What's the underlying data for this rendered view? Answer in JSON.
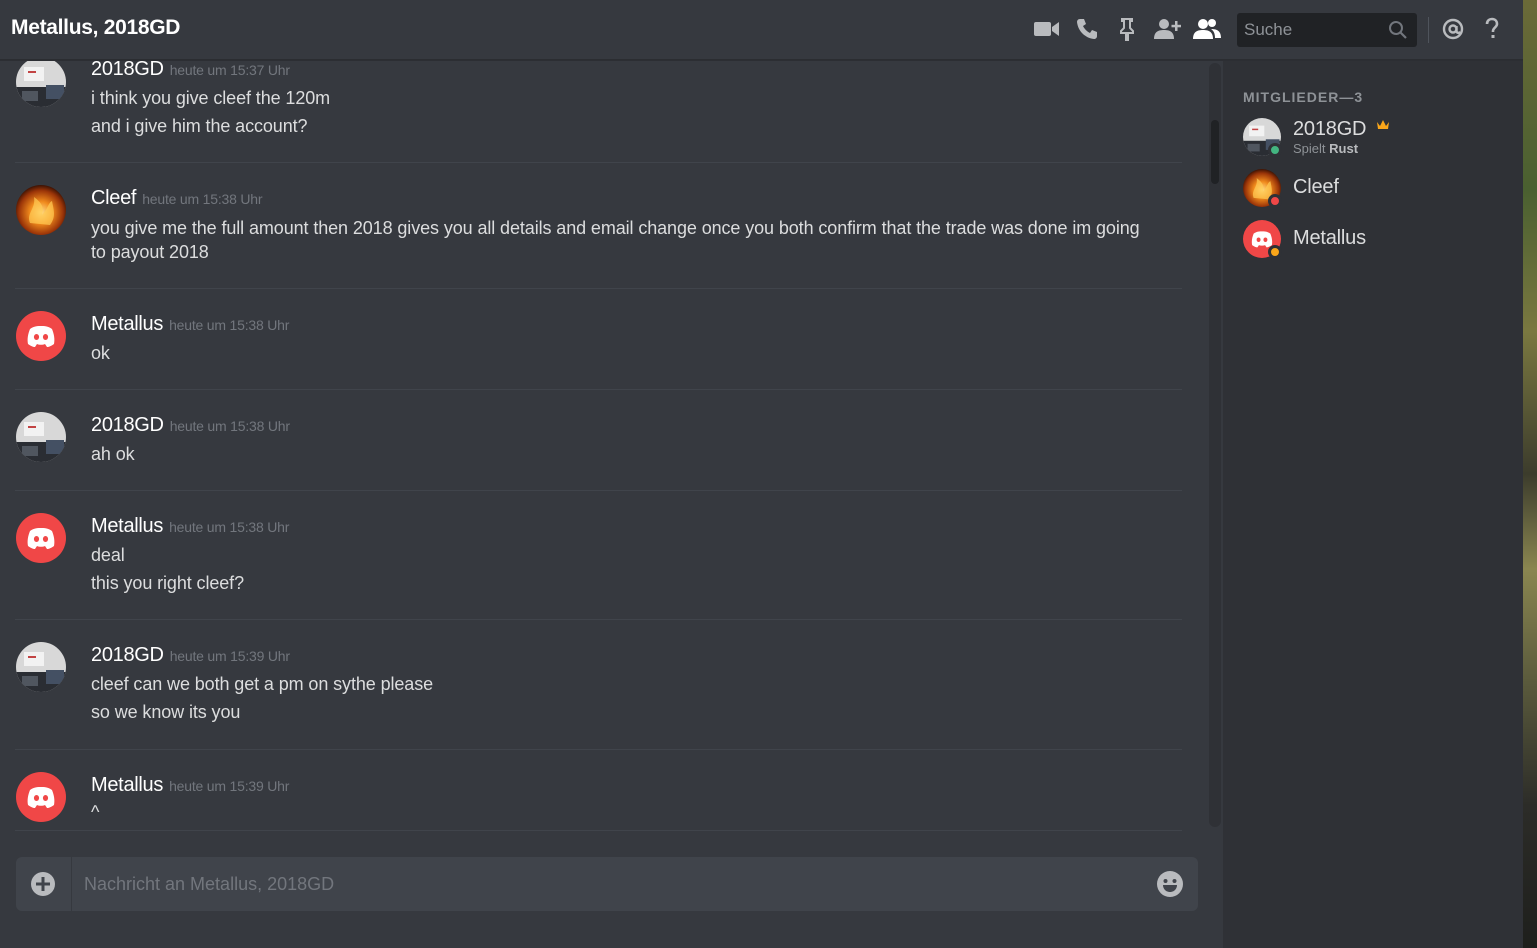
{
  "header": {
    "title": "Metallus, 2018GD",
    "search_placeholder": "Suche"
  },
  "messages": [
    {
      "author": "2018GD",
      "timestamp": "heute um 15:37 Uhr",
      "avatar": "screenshot-avatar",
      "lines": [
        "i think you give cleef the 120m",
        "and i give him the account?"
      ]
    },
    {
      "author": "Cleef",
      "timestamp": "heute um 15:38 Uhr",
      "avatar": "fire-avatar",
      "lines": [
        "you give me the full amount  then 2018 gives you all details and email change once you both confirm that the trade was done im going",
        "to payout 2018"
      ]
    },
    {
      "author": "Metallus",
      "timestamp": "heute um 15:38 Uhr",
      "avatar": "discord-default-avatar",
      "lines": [
        "ok"
      ]
    },
    {
      "author": "2018GD",
      "timestamp": "heute um 15:38 Uhr",
      "avatar": "screenshot-avatar",
      "lines": [
        "ah ok"
      ]
    },
    {
      "author": "Metallus",
      "timestamp": "heute um 15:38 Uhr",
      "avatar": "discord-default-avatar",
      "lines": [
        "deal",
        "this you right cleef?"
      ]
    },
    {
      "author": "2018GD",
      "timestamp": "heute um 15:39 Uhr",
      "avatar": "screenshot-avatar",
      "lines": [
        "cleef can we both  get a pm on sythe please",
        "so we know its you"
      ]
    },
    {
      "author": "Metallus",
      "timestamp": "heute um 15:39 Uhr",
      "avatar": "discord-default-avatar",
      "lines": [
        "^"
      ]
    }
  ],
  "composer": {
    "placeholder": "Nachricht an Metallus, 2018GD"
  },
  "members": {
    "header": "MITGLIEDER—3",
    "list": [
      {
        "name": "2018GD",
        "status": "online",
        "status_color": "#43b581",
        "owner": true,
        "activity_prefix": "Spielt",
        "activity_game": "Rust"
      },
      {
        "name": "Cleef",
        "status": "dnd",
        "status_color": "#f04747"
      },
      {
        "name": "Metallus",
        "status": "idle",
        "status_color": "#faa61a"
      }
    ]
  },
  "colors": {
    "background": "#36393f",
    "sidebar": "#2f3136",
    "accent_red": "#f04747",
    "crown": "#faa61a"
  }
}
